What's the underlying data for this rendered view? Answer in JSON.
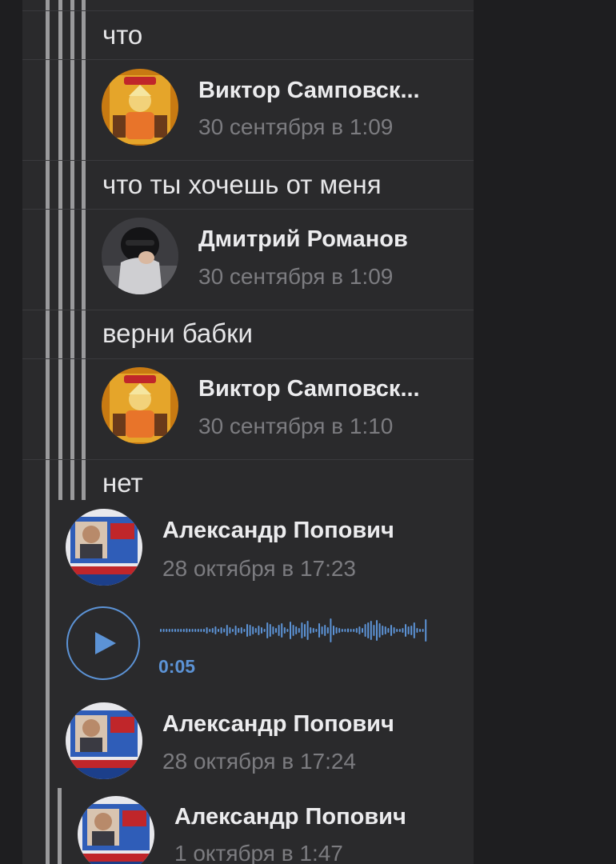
{
  "messages": [
    {
      "text": "что"
    },
    {
      "author": "Виктор Самповск...",
      "date": "30 сентября в 1:09",
      "avatar_icon": "anime-avatar-icon"
    },
    {
      "text": "что ты хочешь от меня"
    },
    {
      "author": "Дмитрий Романов",
      "date": "30 сентября в 1:09",
      "avatar_icon": "hooded-avatar-icon"
    },
    {
      "text": "верни бабки"
    },
    {
      "author": "Виктор Самповск...",
      "date": "30 сентября в 1:10",
      "avatar_icon": "anime-avatar-icon"
    },
    {
      "text": "нет"
    },
    {
      "author": "Александр Попович",
      "date": "28 октября в 17:23",
      "avatar_icon": "tv-avatar-icon"
    },
    {
      "voice": {
        "duration": "0:05",
        "icon": "play-icon"
      }
    },
    {
      "author": "Александр Попович",
      "date": "28 октября в 17:24",
      "avatar_icon": "tv-avatar-icon"
    },
    {
      "author": "Александр Попович",
      "date": "1 октября в 1:47",
      "avatar_icon": "tv-avatar-icon"
    }
  ],
  "colors": {
    "background": "#1e1e20",
    "panel": "#2a2a2c",
    "accent": "#5c93d6",
    "text": "#e6e6e8",
    "muted": "#7c7c80"
  }
}
